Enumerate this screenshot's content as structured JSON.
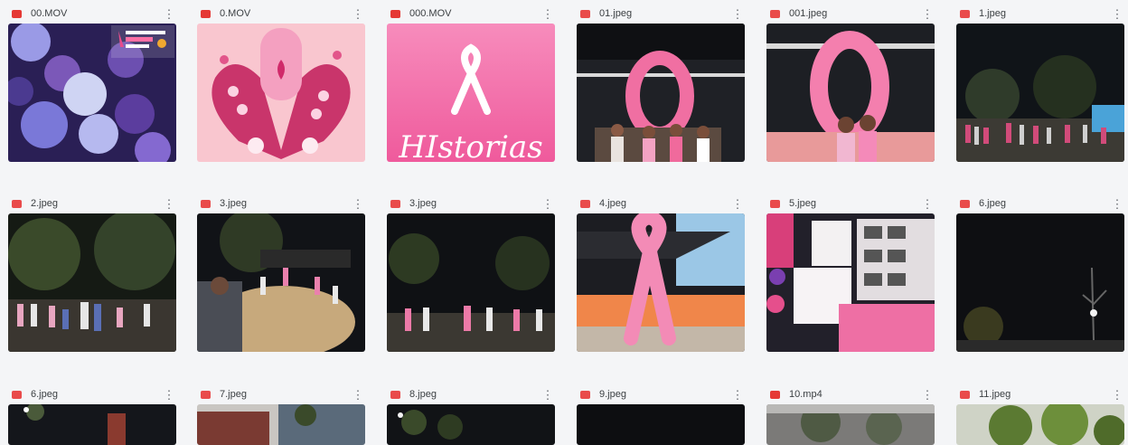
{
  "files": [
    {
      "name": "00.MOV",
      "type": "video",
      "icon": "video-file-icon"
    },
    {
      "name": "0.MOV",
      "type": "video",
      "icon": "video-file-icon"
    },
    {
      "name": "000.MOV",
      "type": "video",
      "icon": "video-file-icon"
    },
    {
      "name": "01.jpeg",
      "type": "image",
      "icon": "image-file-icon"
    },
    {
      "name": "001.jpeg",
      "type": "image",
      "icon": "image-file-icon"
    },
    {
      "name": "1.jpeg",
      "type": "image",
      "icon": "image-file-icon"
    },
    {
      "name": "2.jpeg",
      "type": "image",
      "icon": "image-file-icon"
    },
    {
      "name": "3.jpeg",
      "type": "image",
      "icon": "image-file-icon"
    },
    {
      "name": "3.jpeg",
      "type": "image",
      "icon": "image-file-icon"
    },
    {
      "name": "4.jpeg",
      "type": "image",
      "icon": "image-file-icon"
    },
    {
      "name": "5.jpeg",
      "type": "image",
      "icon": "image-file-icon"
    },
    {
      "name": "6.jpeg",
      "type": "image",
      "icon": "image-file-icon"
    },
    {
      "name": "6.jpeg",
      "type": "image",
      "icon": "image-file-icon"
    },
    {
      "name": "7.jpeg",
      "type": "image",
      "icon": "image-file-icon"
    },
    {
      "name": "8.jpeg",
      "type": "image",
      "icon": "image-file-icon"
    },
    {
      "name": "9.jpeg",
      "type": "image",
      "icon": "image-file-icon"
    },
    {
      "name": "10.mp4",
      "type": "video",
      "icon": "video-file-icon"
    },
    {
      "name": "11.jpeg",
      "type": "image",
      "icon": "image-file-icon"
    }
  ],
  "thumb_text": {
    "historias": "HIstorias"
  },
  "more_icon": "⋮",
  "colors": {
    "pink": "#ec6fa5",
    "background": "#f4f5f7"
  }
}
